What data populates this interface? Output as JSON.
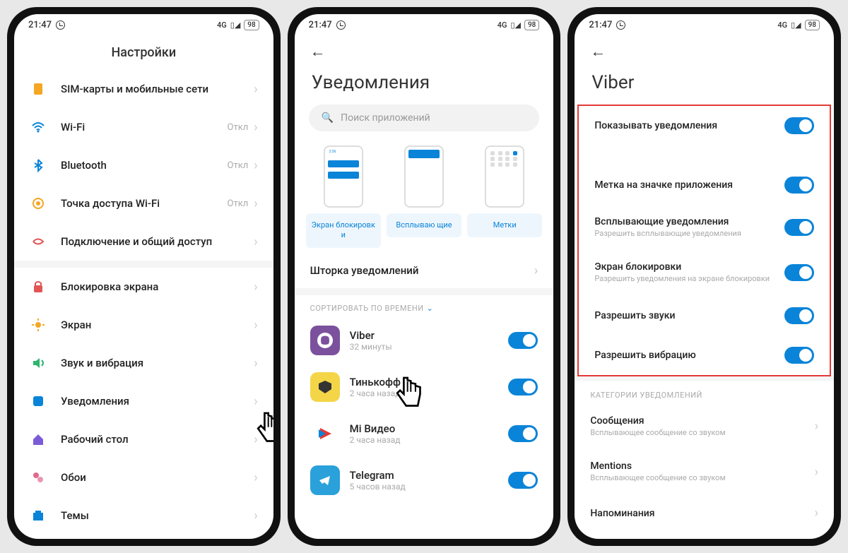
{
  "status": {
    "time": "21:47",
    "battery": "98",
    "net": "4G"
  },
  "screen1": {
    "title": "Настройки",
    "g1": [
      {
        "label": "SIM-карты и мобильные сети",
        "icon_color": "#f5a623",
        "icon": "sim"
      },
      {
        "label": "Wi-Fi",
        "value": "Откл",
        "icon_color": "#0a84d8",
        "icon": "wifi"
      },
      {
        "label": "Bluetooth",
        "value": "Откл",
        "icon_color": "#0a84d8",
        "icon": "bt"
      },
      {
        "label": "Точка доступа Wi-Fi",
        "value": "Откл",
        "icon_color": "#f5a623",
        "icon": "hotspot"
      },
      {
        "label": "Подключение и общий доступ",
        "icon_color": "#e25555",
        "icon": "share"
      }
    ],
    "g2": [
      {
        "label": "Блокировка экрана",
        "icon_color": "#e25555",
        "icon": "lock"
      },
      {
        "label": "Экран",
        "icon_color": "#f5a623",
        "icon": "sun"
      },
      {
        "label": "Звук и вибрация",
        "icon_color": "#2fb66e",
        "icon": "sound"
      },
      {
        "label": "Уведомления",
        "icon_color": "#0a84d8",
        "icon": "notif"
      },
      {
        "label": "Рабочий стол",
        "icon_color": "#7b5cd8",
        "icon": "home"
      },
      {
        "label": "Обои",
        "icon_color": "#e06a8c",
        "icon": "wall"
      },
      {
        "label": "Темы",
        "icon_color": "#0a84d8",
        "icon": "theme"
      }
    ]
  },
  "screen2": {
    "title": "Уведомления",
    "search_placeholder": "Поиск приложений",
    "tabs": [
      "Экран блокировк и",
      "Всплываю щие",
      "Метки"
    ],
    "shade": "Шторка уведомлений",
    "sort": "СОРТИРОВАТЬ ПО ВРЕМЕНИ",
    "apps": [
      {
        "name": "Viber",
        "sub": "32 минуты",
        "color": "#7b519d"
      },
      {
        "name": "Тинькофф",
        "sub": "2 часа назад",
        "color": "#f4d547"
      },
      {
        "name": "Mi Видео",
        "sub": "2 часа назад",
        "color": "#fff"
      },
      {
        "name": "Telegram",
        "sub": "5 часов назад",
        "color": "#2aa1da"
      }
    ]
  },
  "screen3": {
    "title": "Viber",
    "settings": [
      {
        "label": "Показывать уведомления"
      },
      {
        "label": "Метка на значке приложения",
        "gap": true
      },
      {
        "label": "Всплывающие уведомления",
        "sub": "Разрешить всплывающие уведомления"
      },
      {
        "label": "Экран блокировки",
        "sub": "Разрешить уведомления на экране блокировки"
      },
      {
        "label": "Разрешить звуки"
      },
      {
        "label": "Разрешить вибрацию"
      }
    ],
    "cat_header": "КАТЕГОРИИ УВЕДОМЛЕНИЙ",
    "cats": [
      {
        "label": "Сообщения",
        "sub": "Всплывающее сообщение со звуком"
      },
      {
        "label": "Mentions",
        "sub": "Всплывающее сообщение со звуком"
      },
      {
        "label": "Напоминания"
      }
    ]
  }
}
